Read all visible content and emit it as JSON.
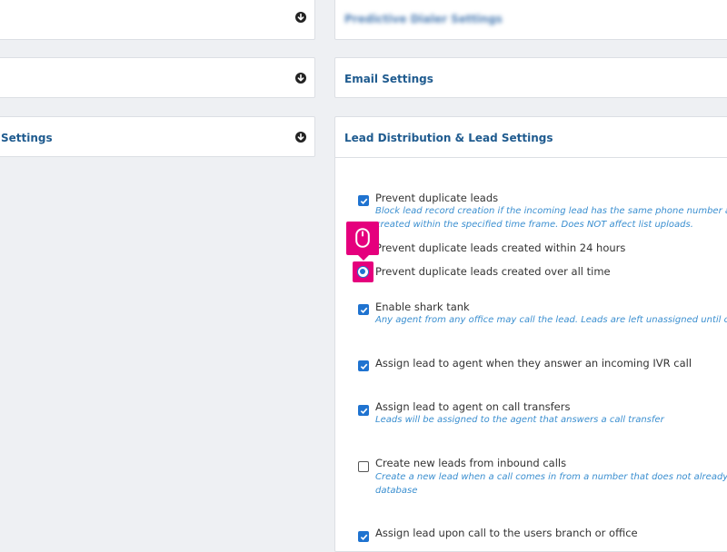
{
  "left_panels": {
    "panel1_title": "",
    "panel2_title": "",
    "panel3_title": "Settings"
  },
  "right_panels": {
    "panel1_title": "Predictive Dialer Settings",
    "panel2_title": "Email Settings",
    "panel3_title": "Lead Distribution & Lead Settings"
  },
  "lead_settings": {
    "prevent_duplicates": {
      "label": "Prevent duplicate leads",
      "desc1": "Block lead record creation if the incoming lead has the same phone number as a le",
      "desc2": "created within the specified time frame. Does NOT affect list uploads."
    },
    "radio_24h": "Prevent duplicate leads created within 24 hours",
    "radio_all_time": "Prevent duplicate leads created over all time",
    "shark_tank": {
      "label": "Enable shark tank",
      "desc": "Any agent from any office may call the lead. Leads are left unassigned until called."
    },
    "ivr_assign": {
      "label": "Assign lead to agent when they answer an incoming IVR call"
    },
    "transfer_assign": {
      "label": "Assign lead to agent on call transfers",
      "desc": "Leads will be assigned to the agent that answers a call transfer"
    },
    "create_inbound": {
      "label": "Create new leads from inbound calls",
      "desc1": "Create a new lead when a call comes in from a number that does not already exist",
      "desc2": "database"
    },
    "branch_assign": {
      "label": "Assign lead upon call to the users branch or office"
    }
  },
  "colors": {
    "accent": "#1f73d0",
    "title": "#1f5b8f",
    "description": "#3b8fd0",
    "cursor_highlight": "#e5007d"
  },
  "icons": {
    "collapse": "circle-arrow-down-icon",
    "cursor": "mouse-icon"
  }
}
